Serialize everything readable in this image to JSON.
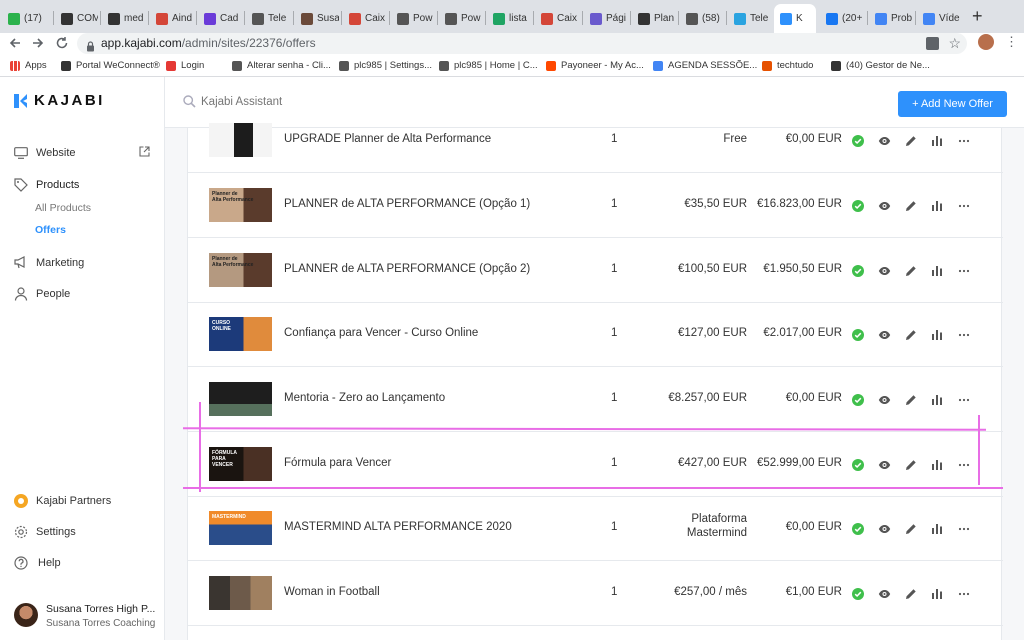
{
  "browser": {
    "tabs": [
      {
        "label": "(17)",
        "color": "#2bb24c"
      },
      {
        "label": "COM",
        "color": "#333"
      },
      {
        "label": "med",
        "color": "#333"
      },
      {
        "label": "Aind",
        "color": "#d44638"
      },
      {
        "label": "Cad",
        "color": "#6a3bd8"
      },
      {
        "label": "Tele",
        "color": "#555"
      },
      {
        "label": "Susa",
        "color": "#6b4a3a"
      },
      {
        "label": "Caix",
        "color": "#d44638"
      },
      {
        "label": "Pow",
        "color": "#555"
      },
      {
        "label": "Pow",
        "color": "#555"
      },
      {
        "label": "lista",
        "color": "#1fa463"
      },
      {
        "label": "Caix",
        "color": "#d44638"
      },
      {
        "label": "Pági",
        "color": "#6a5acd"
      },
      {
        "label": "Plan",
        "color": "#333"
      },
      {
        "label": "(58)",
        "color": "#555"
      },
      {
        "label": "Tele",
        "color": "#2aa3e0"
      },
      {
        "label": "K",
        "color": "#2e91fc"
      },
      {
        "label": "(20+",
        "color": "#1877f2"
      },
      {
        "label": "Prob",
        "color": "#4285f4"
      },
      {
        "label": "Víde",
        "color": "#4285f4"
      }
    ],
    "url_host": "app.kajabi.com",
    "url_path": "/admin/sites/22376/offers",
    "bookmarks": [
      {
        "label": "Apps",
        "color": "#ea4335"
      },
      {
        "label": "Portal WeConnect®",
        "color": "#333"
      },
      {
        "label": "Login",
        "color": "#e53935"
      },
      {
        "label": "Alterar senha - Cli...",
        "color": "#555"
      },
      {
        "label": "plc985 | Settings...",
        "color": "#555"
      },
      {
        "label": "plc985 | Home | C...",
        "color": "#555"
      },
      {
        "label": "Payoneer - My Ac...",
        "color": "#ff4800"
      },
      {
        "label": "AGENDA SESSÕE...",
        "color": "#4285f4"
      },
      {
        "label": "techtudo",
        "color": "#e65100"
      },
      {
        "label": "(40) Gestor de Ne...",
        "color": "#333"
      }
    ]
  },
  "app": {
    "logo": "KAJABI",
    "search_placeholder": "Kajabi Assistant",
    "add_button": "+  Add New Offer",
    "accent": "#2e91fc"
  },
  "sidebar": {
    "website": "Website",
    "products": "Products",
    "all_products": "All Products",
    "offers": "Offers",
    "marketing": "Marketing",
    "people": "People",
    "partners": "Kajabi Partners",
    "settings": "Settings",
    "help": "Help",
    "user_name": "Susana Torres High P...",
    "user_org": "Susana Torres Coaching"
  },
  "offers": [
    {
      "title": "UPGRADE Planner de Alta Performance",
      "qty": "1",
      "price": "Free",
      "price2": "",
      "revenue": "€0,00 EUR"
    },
    {
      "title": "PLANNER de ALTA PERFORMANCE (Opção 1)",
      "qty": "1",
      "price": "€35,50 EUR",
      "price2": "",
      "revenue": "€16.823,00 EUR"
    },
    {
      "title": "PLANNER de ALTA PERFORMANCE (Opção 2)",
      "qty": "1",
      "price": "€100,50 EUR",
      "price2": "",
      "revenue": "€1.950,50 EUR"
    },
    {
      "title": "Confiança para Vencer - Curso Online",
      "qty": "1",
      "price": "€127,00 EUR",
      "price2": "",
      "revenue": "€2.017,00 EUR"
    },
    {
      "title": "Mentoria - Zero ao Lançamento",
      "qty": "1",
      "price": "€8.257,00 EUR",
      "price2": "",
      "revenue": "€0,00 EUR"
    },
    {
      "title": "Fórmula para Vencer",
      "qty": "1",
      "price": "€427,00 EUR",
      "price2": "",
      "revenue": "€52.999,00 EUR"
    },
    {
      "title": "MASTERMIND ALTA PERFORMANCE 2020",
      "qty": "1",
      "price": "Plataforma",
      "price2": "Mastermind",
      "revenue": "€0,00 EUR"
    },
    {
      "title": "Woman in Football",
      "qty": "1",
      "price": "€257,00 / mês",
      "price2": "",
      "revenue": "€1,00 EUR"
    }
  ],
  "thumb_texts": {
    "t1": "Planner de\nAlta Performance",
    "t2": "Planner de\nAlta Performance",
    "t3": "CURSO\nONLINE",
    "t5": "FÓRMULA\nPARA\nVENCER",
    "t6": "MASTERMIND"
  }
}
